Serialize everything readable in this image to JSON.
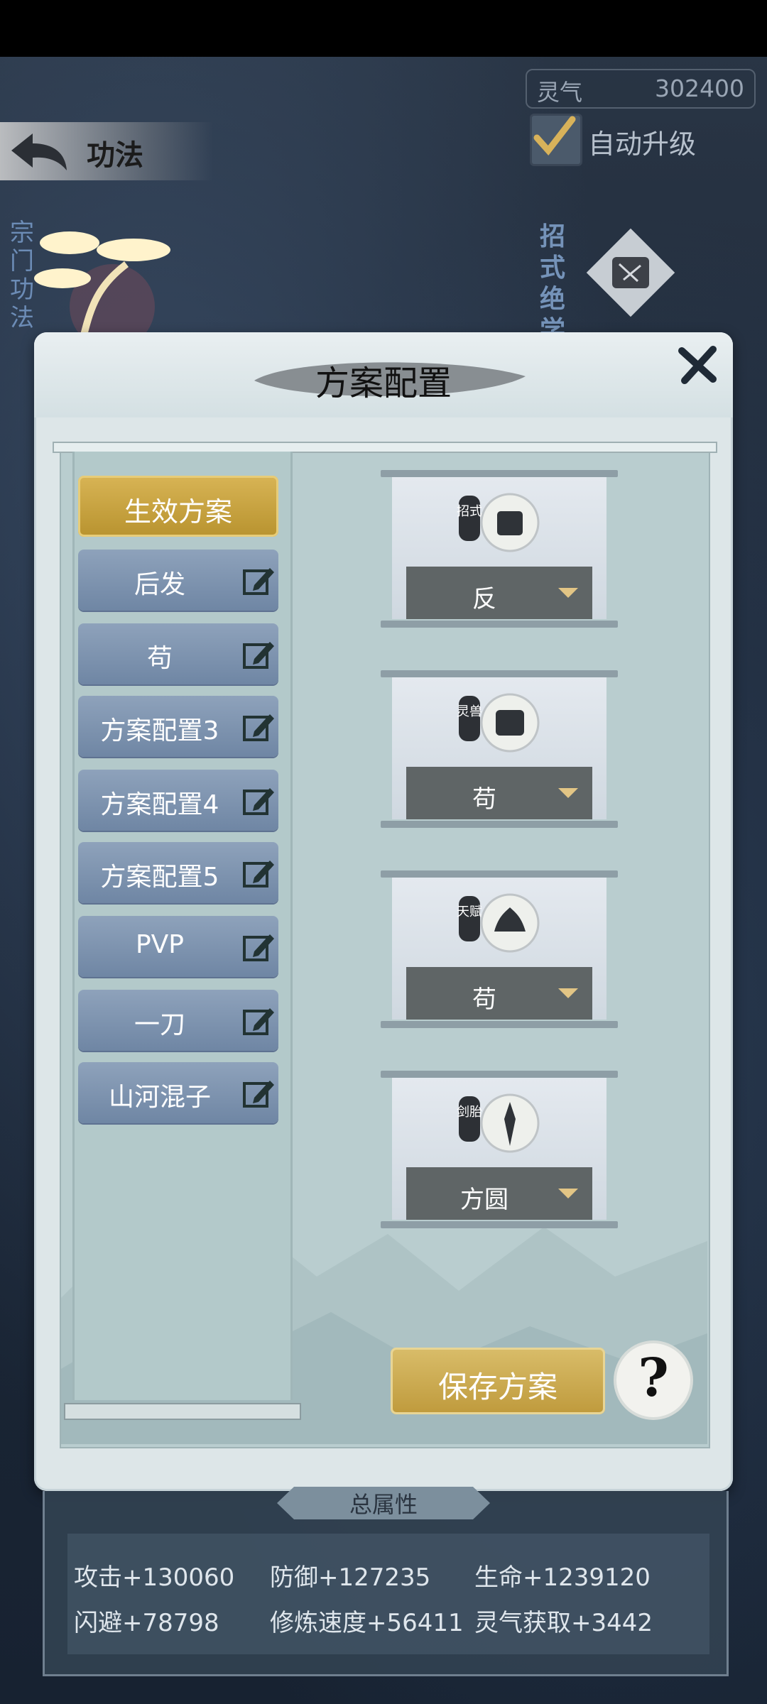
{
  "header": {
    "back_title": "功法",
    "lingqi_label": "灵气",
    "lingqi_value": "302400",
    "auto_upgrade_label": "自动升级",
    "left_side_tab": "宗门功法",
    "right_side_tab": "招式绝学"
  },
  "modal": {
    "title": "方案配置",
    "plans": [
      {
        "label": "生效方案",
        "active": true
      },
      {
        "label": "后发"
      },
      {
        "label": "苟"
      },
      {
        "label": "方案配置3"
      },
      {
        "label": "方案配置4"
      },
      {
        "label": "方案配置5"
      },
      {
        "label": "PVP"
      },
      {
        "label": "一刀"
      },
      {
        "label": "山河混子"
      }
    ],
    "slots": [
      {
        "icon": "moves-scroll-icon",
        "badge": "招式",
        "value": "反"
      },
      {
        "icon": "spirit-beast-icon",
        "badge": "灵兽",
        "value": "苟"
      },
      {
        "icon": "talent-lotus-icon",
        "badge": "天赋",
        "value": "苟"
      },
      {
        "icon": "sword-embryo-icon",
        "badge": "剑胎",
        "value": "方圆"
      }
    ],
    "save_label": "保存方案",
    "help_label": "?"
  },
  "attributes": {
    "tab_label": "总属性",
    "stats": [
      "攻击+130060",
      "防御+127235",
      "生命+1239120",
      "闪避+78798",
      "修炼速度+56411",
      "灵气获取+3442"
    ]
  },
  "colors": {
    "gold": "#c9a746",
    "plan_blue": "#7d93b0",
    "select_gray": "#5f6566",
    "panel_bg": "#dde6e8"
  }
}
